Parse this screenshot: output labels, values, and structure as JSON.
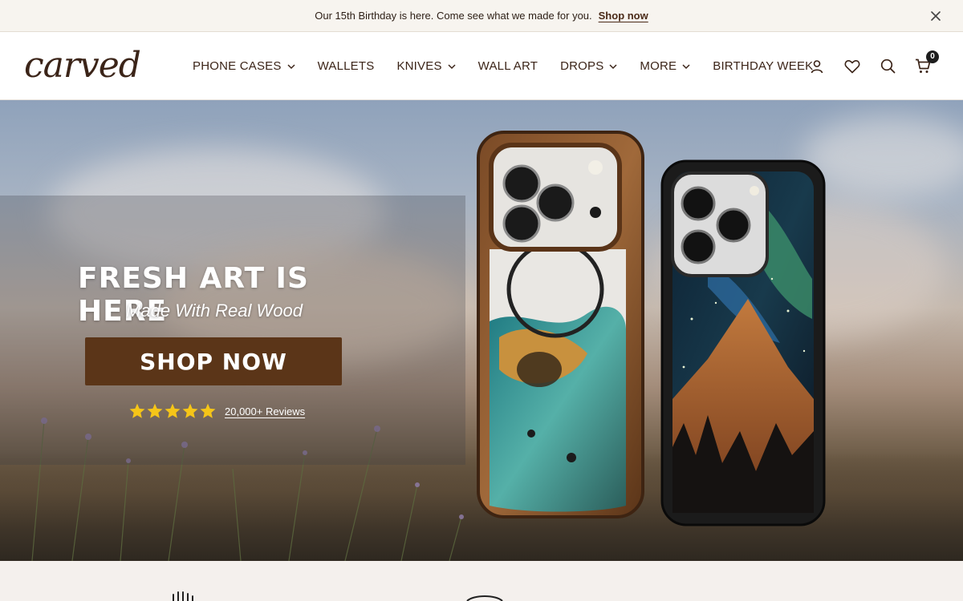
{
  "announcement": {
    "message": "Our 15th Birthday is here. Come see what we made for you.",
    "link": "Shop now",
    "close_icon": "close-icon"
  },
  "header": {
    "logo": "carved",
    "nav": [
      {
        "label": "PHONE CASES",
        "has_dropdown": true
      },
      {
        "label": "WALLETS",
        "has_dropdown": false
      },
      {
        "label": "KNIVES",
        "has_dropdown": true
      },
      {
        "label": "WALL ART",
        "has_dropdown": false
      },
      {
        "label": "DROPS",
        "has_dropdown": true
      },
      {
        "label": "MORE",
        "has_dropdown": true
      },
      {
        "label": "BIRTHDAY WEEK",
        "has_dropdown": false
      }
    ],
    "icons": [
      "account-icon",
      "wishlist-icon",
      "search-icon",
      "cart-icon"
    ],
    "cart_count": "0"
  },
  "hero": {
    "title": "FRESH ART IS HERE",
    "subtitle": "Made With Real Wood",
    "cta": "SHOP NOW",
    "rating_stars": 5,
    "reviews_label": "20,000+ Reviews"
  },
  "colors": {
    "brand_brown": "#5b3518",
    "text_dark": "#3b2418",
    "announcement_bg": "#f7f4ef",
    "star": "#f5c518"
  }
}
